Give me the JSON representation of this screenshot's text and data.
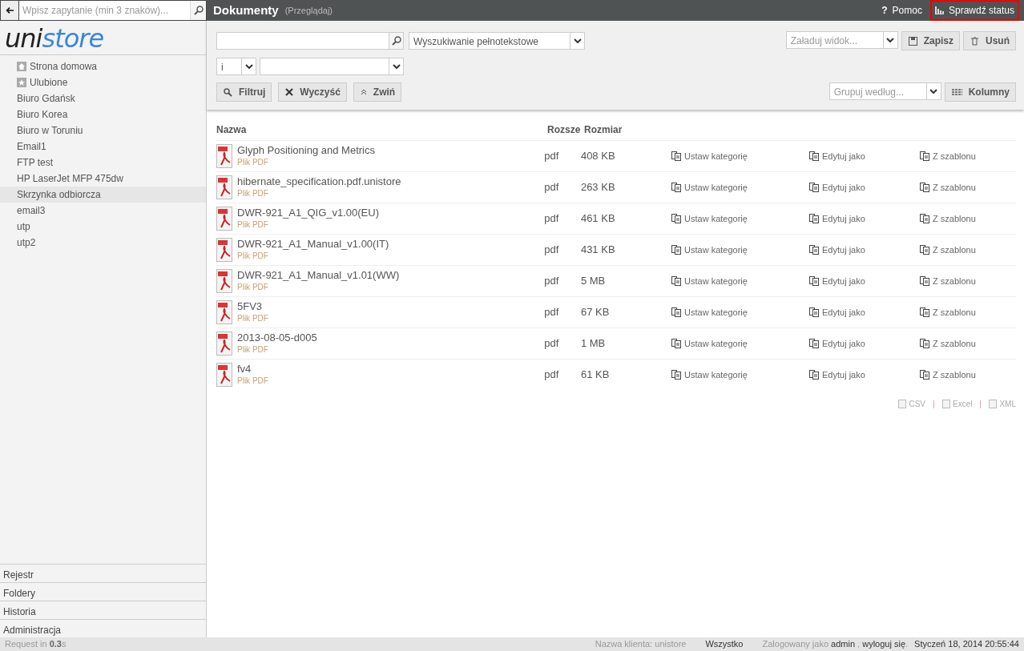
{
  "search": {
    "placeholder": "Wpisz zapytanie (min 3 znaków)..."
  },
  "logo": {
    "prefix": "uni",
    "suffix": "store"
  },
  "header": {
    "title": "Dokumenty",
    "subtitle": "(Przeglądaj)"
  },
  "header_links": [
    {
      "label": "?",
      "text": "Pomoc",
      "kind": "help",
      "highlighted": false
    },
    {
      "text": "Sprawdź status",
      "kind": "status",
      "highlighted": true
    }
  ],
  "sidebar": {
    "items": [
      {
        "label": "Strona domowa",
        "kind": "home",
        "selected": false
      },
      {
        "label": "Ulubione",
        "kind": "star",
        "selected": false
      },
      {
        "label": "Biuro Gdańsk",
        "kind": "plain",
        "selected": false
      },
      {
        "label": "Biuro Korea",
        "kind": "plain",
        "selected": false
      },
      {
        "label": "Biuro w Toruniu",
        "kind": "plain",
        "selected": false
      },
      {
        "label": "Email1",
        "kind": "plain",
        "selected": false
      },
      {
        "label": "FTP test",
        "kind": "plain",
        "selected": false
      },
      {
        "label": "HP LaserJet MFP 475dw",
        "kind": "plain",
        "selected": false
      },
      {
        "label": "Skrzynka odbiorcza",
        "kind": "plain",
        "selected": true
      },
      {
        "label": "email3",
        "kind": "plain",
        "selected": false
      },
      {
        "label": "utp",
        "kind": "plain",
        "selected": false
      },
      {
        "label": "utp2",
        "kind": "plain",
        "selected": false
      }
    ],
    "sections": [
      "Rejestr",
      "Foldery",
      "Historia",
      "Administracja"
    ]
  },
  "toolbar": {
    "search_mode": "Wyszukiwanie pełnotekstowe",
    "operator": "i",
    "view_placeholder": "Załaduj widok...",
    "group_placeholder": "Grupuj według...",
    "buttons": [
      {
        "label": "Filtruj",
        "kind": "search"
      },
      {
        "label": "Wyczyść",
        "kind": "clear"
      },
      {
        "label": "Zwiń",
        "kind": "collapse"
      }
    ],
    "view_buttons": [
      {
        "label": "Zapisz",
        "kind": "save"
      },
      {
        "label": "Usuń",
        "kind": "delete"
      }
    ],
    "columns_button": "Kolumny"
  },
  "table": {
    "columns": [
      "Nazwa",
      "Rozsze",
      "Rozmiar"
    ],
    "rows": [
      {
        "name": "Glyph Positioning and Metrics",
        "type": "Plik PDF",
        "ext": "pdf",
        "size": "408 KB",
        "actions": [
          "Ustaw kategorię",
          "Edytuj jako",
          "Z szablonu"
        ]
      },
      {
        "name": "hibernate_specification.pdf.unistore",
        "type": "Plik PDF",
        "ext": "pdf",
        "size": "263 KB",
        "actions": [
          "Ustaw kategorię",
          "Edytuj jako",
          "Z szablonu"
        ]
      },
      {
        "name": "DWR-921_A1_QIG_v1.00(EU)",
        "type": "Plik PDF",
        "ext": "pdf",
        "size": "461 KB",
        "actions": [
          "Ustaw kategorię",
          "Edytuj jako",
          "Z szablonu"
        ]
      },
      {
        "name": "DWR-921_A1_Manual_v1.00(IT)",
        "type": "Plik PDF",
        "ext": "pdf",
        "size": "431 KB",
        "actions": [
          "Ustaw kategorię",
          "Edytuj jako",
          "Z szablonu"
        ]
      },
      {
        "name": "DWR-921_A1_Manual_v1.01(WW)",
        "type": "Plik PDF",
        "ext": "pdf",
        "size": "5 MB",
        "actions": [
          "Ustaw kategorię",
          "Edytuj jako",
          "Z szablonu"
        ]
      },
      {
        "name": "5FV3",
        "type": "Plik PDF",
        "ext": "pdf",
        "size": "67 KB",
        "actions": [
          "Ustaw kategorię",
          "Edytuj jako",
          "Z szablonu"
        ]
      },
      {
        "name": "2013-08-05-d005",
        "type": "Plik PDF",
        "ext": "pdf",
        "size": "1 MB",
        "actions": [
          "Ustaw kategorię",
          "Edytuj jako",
          "Z szablonu"
        ]
      },
      {
        "name": "fv4",
        "type": "Plik PDF",
        "ext": "pdf",
        "size": "61 KB",
        "actions": [
          "Ustaw kategorię",
          "Edytuj jako",
          "Z szablonu"
        ]
      }
    ]
  },
  "exports": [
    "CSV",
    "Excel",
    "XML"
  ],
  "status_bar": {
    "request": "Request in **0.3**s",
    "client": "Nazwa klienta: unistore",
    "scope": "Wszystko",
    "login_prefix": "Zalogowany jako",
    "user": "admin",
    "separator": ",",
    "logout": "wyloguj się",
    "login_end": ".",
    "datetime": "Styczeń 18, 2014 20:55:44"
  }
}
